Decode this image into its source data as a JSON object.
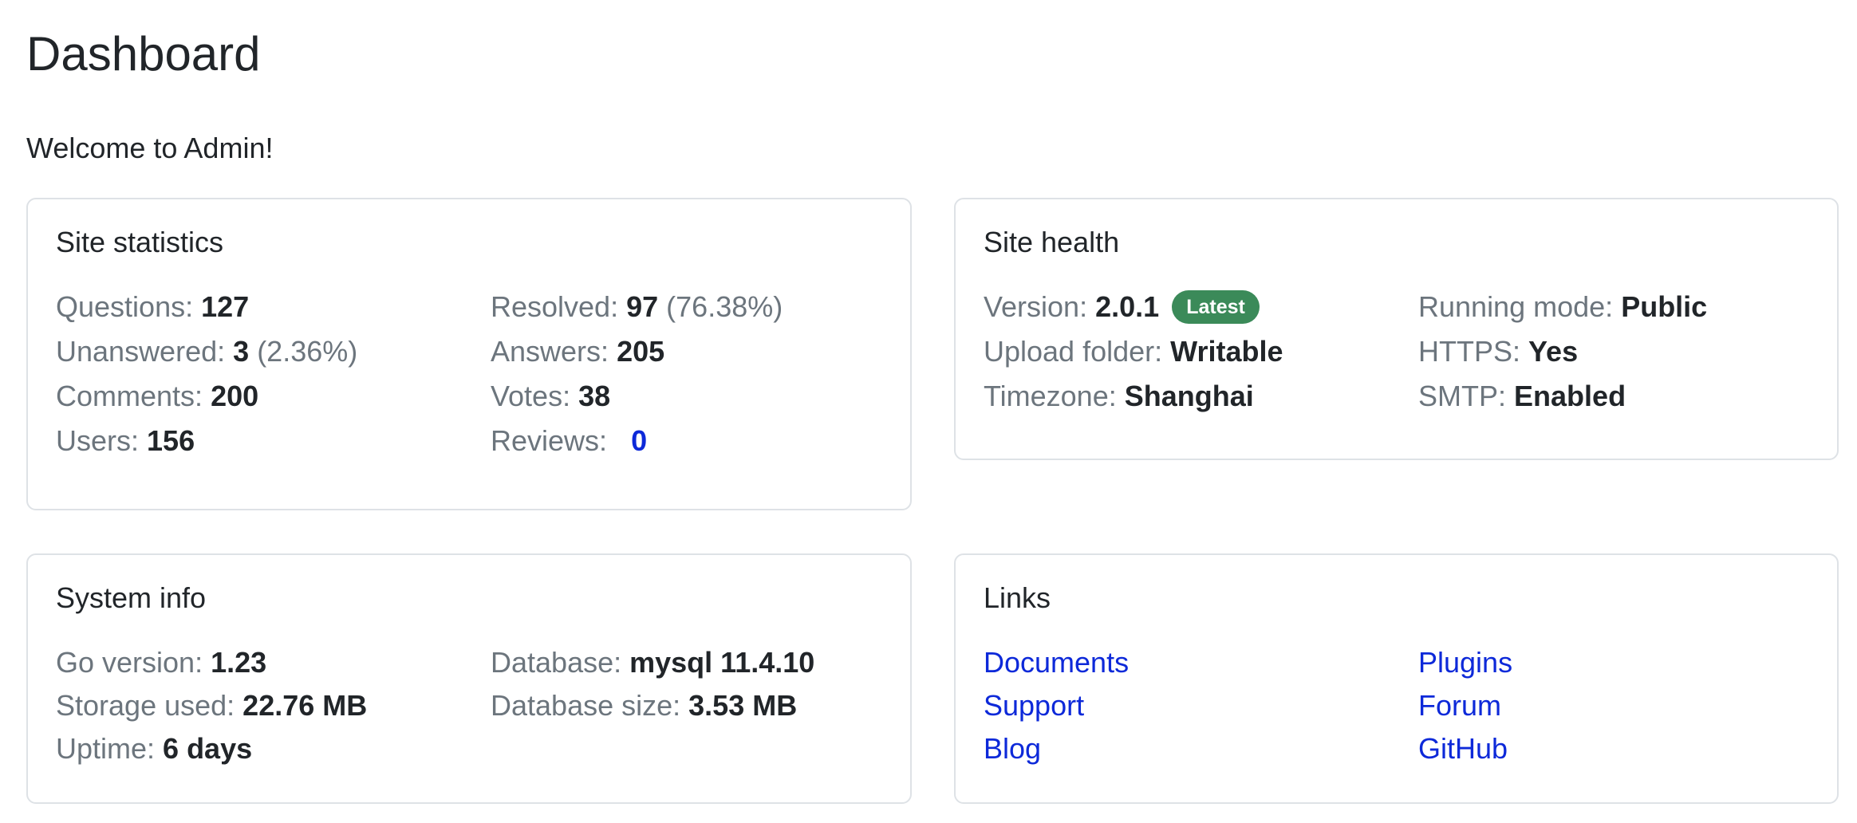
{
  "page": {
    "title": "Dashboard",
    "welcome": "Welcome to Admin!"
  },
  "site_statistics": {
    "title": "Site statistics",
    "questions": {
      "label": "Questions:",
      "value": "127"
    },
    "resolved": {
      "label": "Resolved:",
      "value": "97",
      "pct": "(76.38%)"
    },
    "unanswered": {
      "label": "Unanswered:",
      "value": "3",
      "pct": "(2.36%)"
    },
    "answers": {
      "label": "Answers:",
      "value": "205"
    },
    "comments": {
      "label": "Comments:",
      "value": "200"
    },
    "votes": {
      "label": "Votes:",
      "value": "38"
    },
    "users": {
      "label": "Users:",
      "value": "156"
    },
    "reviews": {
      "label": "Reviews:",
      "value": "0"
    }
  },
  "site_health": {
    "title": "Site health",
    "version": {
      "label": "Version:",
      "value": "2.0.1",
      "badge": "Latest"
    },
    "running_mode": {
      "label": "Running mode:",
      "value": "Public"
    },
    "upload_folder": {
      "label": "Upload folder:",
      "value": "Writable"
    },
    "https": {
      "label": "HTTPS:",
      "value": "Yes"
    },
    "timezone": {
      "label": "Timezone:",
      "value": "Shanghai"
    },
    "smtp": {
      "label": "SMTP:",
      "value": "Enabled"
    }
  },
  "system_info": {
    "title": "System info",
    "go_version": {
      "label": "Go version:",
      "value": "1.23"
    },
    "database": {
      "label": "Database:",
      "value": "mysql 11.4.10"
    },
    "storage_used": {
      "label": "Storage used:",
      "value": "22.76 MB"
    },
    "database_size": {
      "label": "Database size:",
      "value": "3.53 MB"
    },
    "uptime": {
      "label": "Uptime:",
      "value": "6 days"
    }
  },
  "links": {
    "title": "Links",
    "items": [
      "Documents",
      "Plugins",
      "Support",
      "Forum",
      "Blog",
      "GitHub"
    ]
  },
  "colors": {
    "link": "#0d29d9",
    "badge": "#3b8a59",
    "muted": "#6c757d",
    "border": "#dee2e6"
  }
}
